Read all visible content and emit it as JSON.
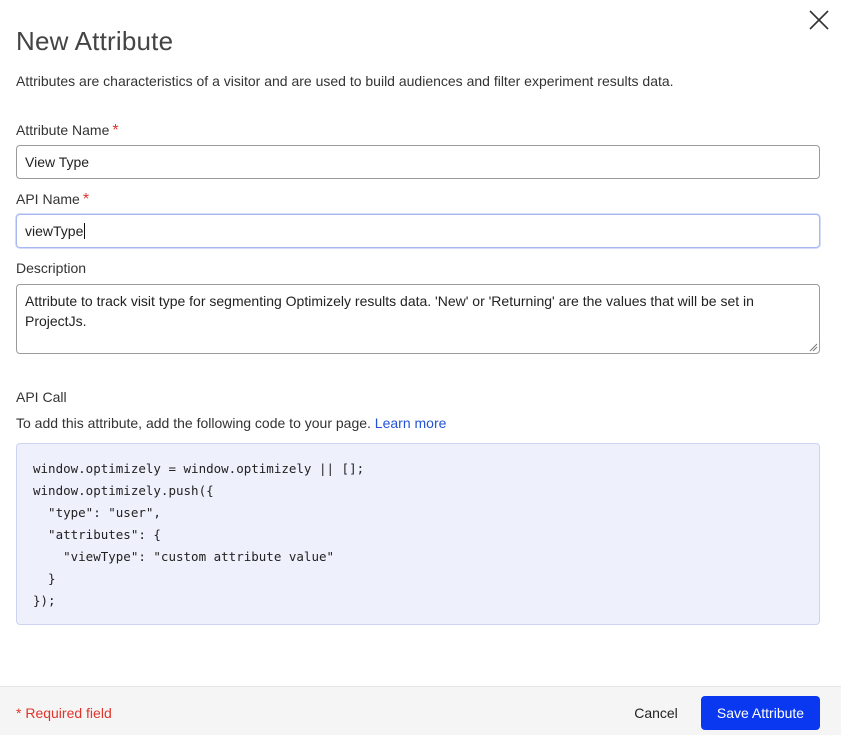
{
  "dialog": {
    "title": "New Attribute",
    "intro": "Attributes are characteristics of a visitor and are used to build audiences and filter experiment results data."
  },
  "fields": {
    "attribute_name": {
      "label": "Attribute Name",
      "required_mark": "*",
      "value": "View Type"
    },
    "api_name": {
      "label": "API Name",
      "required_mark": "*",
      "value": "viewType"
    },
    "description": {
      "label": "Description",
      "value": "Attribute to track visit type for segmenting Optimizely results data. 'New' or 'Returning' are the values that will be set in ProjectJs."
    }
  },
  "api_call": {
    "label": "API Call",
    "help_text": "To add this attribute, add the following code to your page.",
    "learn_more": "Learn more",
    "code_lines": [
      "window.optimizely = window.optimizely || [];",
      "window.optimizely.push({",
      "  \"type\": \"user\",",
      "  \"attributes\": {",
      "    \"viewType\": \"custom attribute value\"",
      "  }",
      "});"
    ]
  },
  "footer": {
    "required_note": "* Required field",
    "cancel_label": "Cancel",
    "save_label": "Save Attribute"
  },
  "icons": {
    "close": "close-icon",
    "resize": "resize-grip-icon"
  },
  "colors": {
    "accent": "#0a37f0",
    "required": "#e0352b",
    "link": "#2454d6",
    "code_bg": "#eef0fc"
  }
}
